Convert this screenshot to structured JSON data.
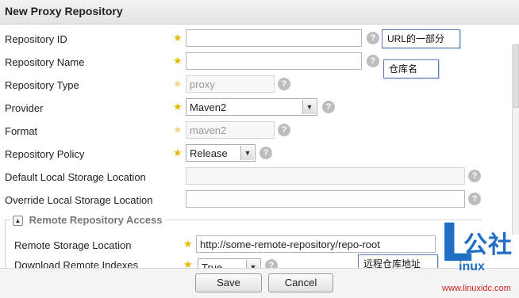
{
  "header": {
    "title": "New Proxy Repository"
  },
  "fields": {
    "repository_id": {
      "label": "Repository ID",
      "value": ""
    },
    "repository_name": {
      "label": "Repository Name",
      "value": ""
    },
    "repository_type": {
      "label": "Repository Type",
      "value": "proxy"
    },
    "provider": {
      "label": "Provider",
      "value": "Maven2"
    },
    "format": {
      "label": "Format",
      "value": "maven2"
    },
    "repository_policy": {
      "label": "Repository Policy",
      "value": "Release"
    },
    "default_local_storage": {
      "label": "Default Local Storage Location",
      "value": ""
    },
    "override_local_storage": {
      "label": "Override Local Storage Location",
      "value": ""
    }
  },
  "remote_section": {
    "legend": "Remote Repository Access",
    "remote_storage": {
      "label": "Remote Storage Location",
      "value": "http://some-remote-repository/repo-root"
    },
    "download_indexes": {
      "label": "Download Remote Indexes",
      "value": "True"
    }
  },
  "annotations": {
    "url_part": "URL的一部分",
    "repo_name": "仓库名",
    "remote_addr": "远程仓库地址"
  },
  "footer": {
    "save": "Save",
    "cancel": "Cancel"
  },
  "watermark": {
    "brand_letter": "L",
    "brand_rest": "inux",
    "brand_cn": "公社",
    "url": "www.linuxidc.com"
  },
  "icons": {
    "required": "★",
    "help": "?",
    "dropdown": "▼",
    "collapse": "▲"
  },
  "colors": {
    "required_star": "#e8b900",
    "callout_border": "#5a7fb0",
    "watermark_blue": "#1f6fc4",
    "watermark_red": "#d02020"
  }
}
